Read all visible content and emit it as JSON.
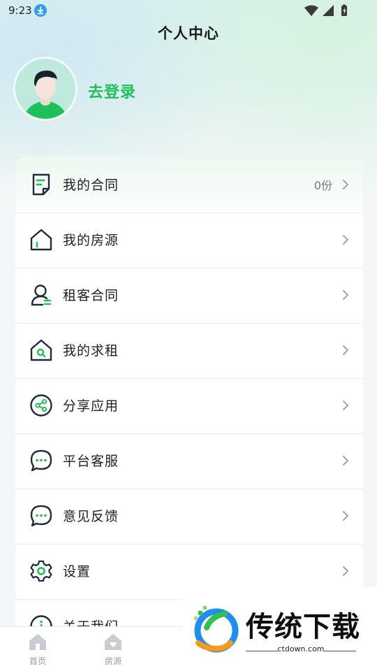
{
  "status_bar": {
    "time": "9:23"
  },
  "header": {
    "title": "个人中心"
  },
  "profile": {
    "login_label": "去登录"
  },
  "menu": {
    "items": [
      {
        "label": "我的合同",
        "value": "0份",
        "icon": "contract-icon"
      },
      {
        "label": "我的房源",
        "value": "",
        "icon": "house-icon"
      },
      {
        "label": "租客合同",
        "value": "",
        "icon": "tenant-icon"
      },
      {
        "label": "我的求租",
        "value": "",
        "icon": "house-search-icon"
      },
      {
        "label": "分享应用",
        "value": "",
        "icon": "share-icon"
      },
      {
        "label": "平台客服",
        "value": "",
        "icon": "chat-icon"
      },
      {
        "label": "意见反馈",
        "value": "",
        "icon": "feedback-icon"
      },
      {
        "label": "设置",
        "value": "",
        "icon": "gear-icon"
      },
      {
        "label": "关于我们",
        "value": "",
        "icon": "info-icon"
      }
    ]
  },
  "tab_bar": {
    "tabs": [
      {
        "label": "首页",
        "icon": "home-icon"
      },
      {
        "label": "房源",
        "icon": "listing-icon"
      }
    ]
  },
  "watermark": {
    "brand": "传统下载",
    "url": "ctdown.com"
  },
  "colors": {
    "accent": "#20c157",
    "icon_stroke": "#1f2a3a",
    "text": "#222222",
    "muted": "#999999"
  }
}
